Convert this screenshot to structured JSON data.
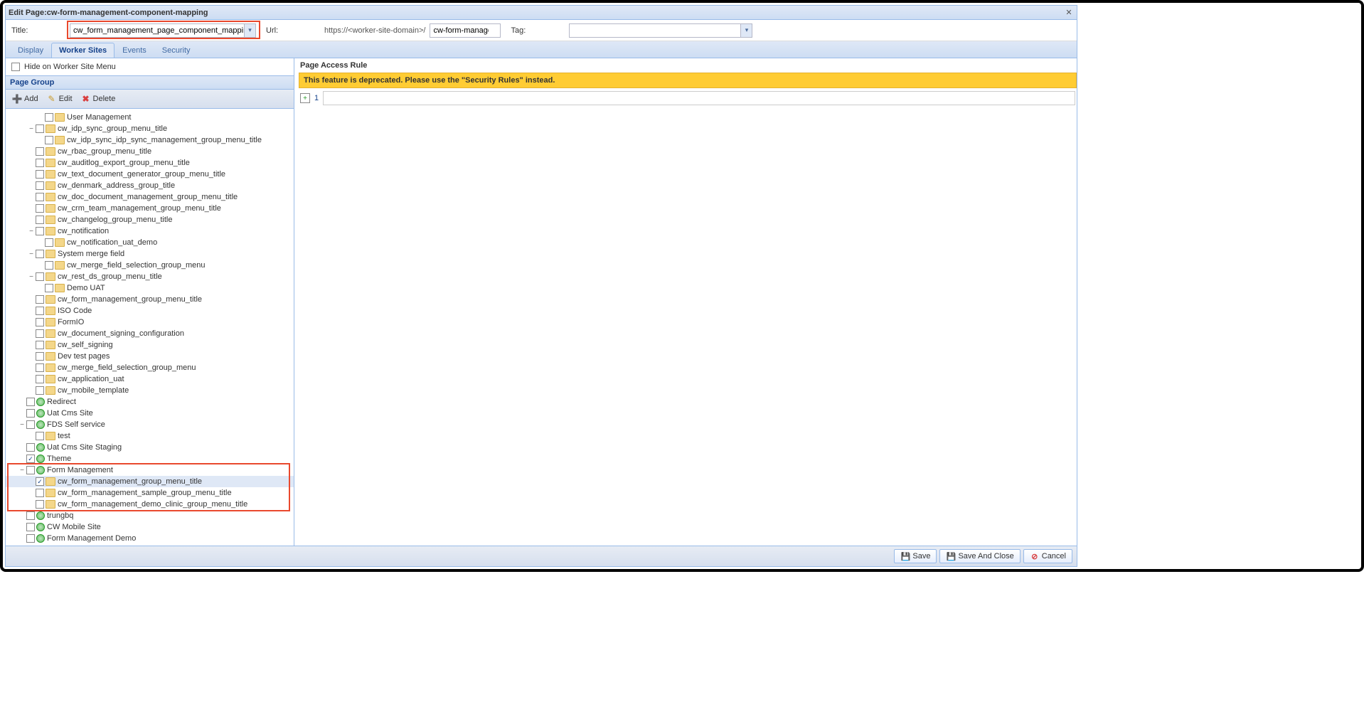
{
  "header": {
    "title_prefix": "Edit Page: ",
    "page_name": "cw-form-management-component-mapping"
  },
  "form": {
    "title_label": "Title:",
    "title_value": "cw_form_management_page_component_mapping",
    "url_label": "Url:",
    "url_prefix": "https://<worker-site-domain>/",
    "url_value": "cw-form-management-c",
    "tag_label": "Tag:",
    "tag_value": ""
  },
  "tabs": {
    "display": "Display",
    "worker_sites": "Worker Sites",
    "events": "Events",
    "security": "Security"
  },
  "left": {
    "hide_label": "Hide on Worker Site Menu",
    "page_group": "Page Group",
    "add": "Add",
    "edit": "Edit",
    "delete": "Delete"
  },
  "right": {
    "header": "Page Access Rule",
    "deprecation": "This feature is deprecated. Please use the \"Security Rules\" instead.",
    "rule_num": "1"
  },
  "tree": [
    {
      "indent": 3,
      "exp": "",
      "chk": false,
      "type": "folder",
      "label": "User Management"
    },
    {
      "indent": 2,
      "exp": "−",
      "chk": false,
      "type": "folder",
      "label": "cw_idp_sync_group_menu_title"
    },
    {
      "indent": 3,
      "exp": "",
      "chk": false,
      "type": "folder",
      "label": "cw_idp_sync_idp_sync_management_group_menu_title"
    },
    {
      "indent": 2,
      "exp": "",
      "chk": false,
      "type": "folder",
      "label": "cw_rbac_group_menu_title"
    },
    {
      "indent": 2,
      "exp": "",
      "chk": false,
      "type": "folder",
      "label": "cw_auditlog_export_group_menu_title"
    },
    {
      "indent": 2,
      "exp": "",
      "chk": false,
      "type": "folder",
      "label": "cw_text_document_generator_group_menu_title"
    },
    {
      "indent": 2,
      "exp": "",
      "chk": false,
      "type": "folder",
      "label": "cw_denmark_address_group_title"
    },
    {
      "indent": 2,
      "exp": "",
      "chk": false,
      "type": "folder",
      "label": "cw_doc_document_management_group_menu_title"
    },
    {
      "indent": 2,
      "exp": "",
      "chk": false,
      "type": "folder",
      "label": "cw_crm_team_management_group_menu_title"
    },
    {
      "indent": 2,
      "exp": "",
      "chk": false,
      "type": "folder",
      "label": "cw_changelog_group_menu_title"
    },
    {
      "indent": 2,
      "exp": "−",
      "chk": false,
      "type": "folder",
      "label": "cw_notification"
    },
    {
      "indent": 3,
      "exp": "",
      "chk": false,
      "type": "folder",
      "label": "cw_notification_uat_demo"
    },
    {
      "indent": 2,
      "exp": "−",
      "chk": false,
      "type": "folder",
      "label": "System merge field"
    },
    {
      "indent": 3,
      "exp": "",
      "chk": false,
      "type": "folder",
      "label": "cw_merge_field_selection_group_menu"
    },
    {
      "indent": 2,
      "exp": "−",
      "chk": false,
      "type": "folder",
      "label": "cw_rest_ds_group_menu_title"
    },
    {
      "indent": 3,
      "exp": "",
      "chk": false,
      "type": "folder",
      "label": "Demo UAT"
    },
    {
      "indent": 2,
      "exp": "",
      "chk": false,
      "type": "folder",
      "label": "cw_form_management_group_menu_title"
    },
    {
      "indent": 2,
      "exp": "",
      "chk": false,
      "type": "folder",
      "label": "ISO Code"
    },
    {
      "indent": 2,
      "exp": "",
      "chk": false,
      "type": "folder",
      "label": "FormIO"
    },
    {
      "indent": 2,
      "exp": "",
      "chk": false,
      "type": "folder",
      "label": "cw_document_signing_configuration"
    },
    {
      "indent": 2,
      "exp": "",
      "chk": false,
      "type": "folder",
      "label": "cw_self_signing"
    },
    {
      "indent": 2,
      "exp": "",
      "chk": false,
      "type": "folder",
      "label": "Dev test pages"
    },
    {
      "indent": 2,
      "exp": "",
      "chk": false,
      "type": "folder",
      "label": "cw_merge_field_selection_group_menu"
    },
    {
      "indent": 2,
      "exp": "",
      "chk": false,
      "type": "folder",
      "label": "cw_application_uat"
    },
    {
      "indent": 2,
      "exp": "",
      "chk": false,
      "type": "folder",
      "label": "cw_mobile_template"
    },
    {
      "indent": 1,
      "exp": "",
      "chk": false,
      "type": "site",
      "label": "Redirect"
    },
    {
      "indent": 1,
      "exp": "",
      "chk": false,
      "type": "site",
      "label": "Uat Cms Site"
    },
    {
      "indent": 1,
      "exp": "−",
      "chk": false,
      "type": "site",
      "label": "FDS Self service"
    },
    {
      "indent": 2,
      "exp": "",
      "chk": false,
      "type": "folder",
      "label": "test"
    },
    {
      "indent": 1,
      "exp": "",
      "chk": false,
      "type": "site",
      "label": "Uat Cms Site Staging"
    },
    {
      "indent": 1,
      "exp": "",
      "chk": true,
      "type": "site",
      "label": "Theme"
    },
    {
      "indent": 1,
      "exp": "−",
      "chk": false,
      "type": "site",
      "label": "Form Management"
    },
    {
      "indent": 2,
      "exp": "",
      "chk": true,
      "type": "folder",
      "label": "cw_form_management_group_menu_title",
      "selected": true
    },
    {
      "indent": 2,
      "exp": "",
      "chk": false,
      "type": "folder",
      "label": "cw_form_management_sample_group_menu_title"
    },
    {
      "indent": 2,
      "exp": "",
      "chk": false,
      "type": "folder",
      "label": "cw_form_management_demo_clinic_group_menu_title"
    },
    {
      "indent": 1,
      "exp": "",
      "chk": false,
      "type": "site",
      "label": "trungbq"
    },
    {
      "indent": 1,
      "exp": "",
      "chk": false,
      "type": "site",
      "label": "CW Mobile Site"
    },
    {
      "indent": 1,
      "exp": "",
      "chk": false,
      "type": "site",
      "label": "Form Management Demo"
    }
  ],
  "footer": {
    "save": "Save",
    "save_close": "Save And Close",
    "cancel": "Cancel"
  }
}
